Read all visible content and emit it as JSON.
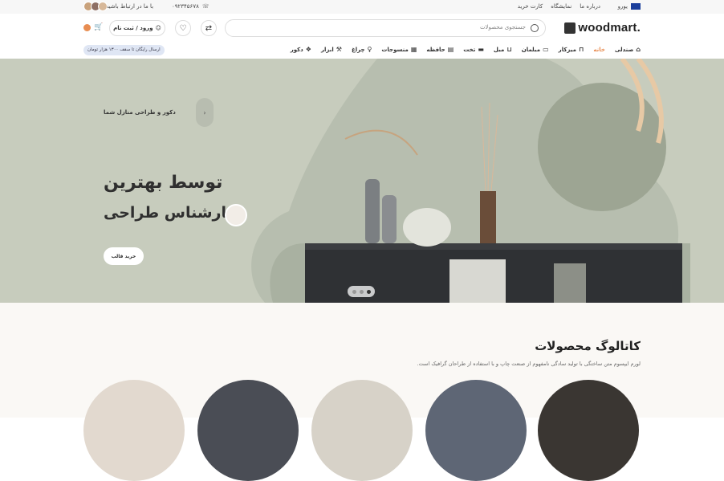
{
  "topbar": {
    "language": "یورو",
    "links": [
      "کارت خرید",
      "نمایشگاه",
      "درباره ما"
    ],
    "phone": "۰۹۲۳۴۵۶۷۸",
    "contact": "با ما در ارتباط باشید"
  },
  "header": {
    "logo": "woodmart.",
    "search_placeholder": "جستجوی محصولات",
    "login_label": "ورود / ثبت نام",
    "cart_icon": "cart-icon",
    "wishlist_icon": "heart-icon",
    "compare_icon": "shuffle-icon"
  },
  "nav": {
    "items": [
      {
        "label": "صندلی",
        "icon": "chair-icon",
        "active": false
      },
      {
        "label": "خانه",
        "icon": "",
        "active": true
      },
      {
        "label": "میزکار",
        "icon": "desk-icon",
        "active": false
      },
      {
        "label": "مبلمان",
        "icon": "sofa-icon",
        "active": false
      },
      {
        "label": "مبل",
        "icon": "armchair-icon",
        "active": false
      },
      {
        "label": "تخت",
        "icon": "bed-icon",
        "active": false
      },
      {
        "label": "حافظه",
        "icon": "cabinet-icon",
        "active": false
      },
      {
        "label": "منسوجات",
        "icon": "textile-icon",
        "active": false
      },
      {
        "label": "چراغ",
        "icon": "lamp-icon",
        "active": false
      },
      {
        "label": "ابزار",
        "icon": "tools-icon",
        "active": false
      },
      {
        "label": "دکور",
        "icon": "decor-icon",
        "active": false
      }
    ],
    "promo": "ارسال رایگان تا سقف ۱۳۰۰ هزار تومان"
  },
  "hero": {
    "subtitle": "دکور و طراحی منازل شما",
    "title_line1": "توسط بهترین",
    "title_line2": "کارشناس طراحی",
    "button": "خرید قالب",
    "slide_count": 3,
    "active_slide": 1
  },
  "catalog": {
    "title": "کاتالوگ محصولات",
    "description": "لورم ایپسوم متن ساختگی با تولید سادگی نامفهوم از صنعت چاپ و با استفاده از طراحان گرافیک است."
  },
  "colors": {
    "accent": "#e88d52",
    "hero_bg": "#c7ccbd"
  }
}
